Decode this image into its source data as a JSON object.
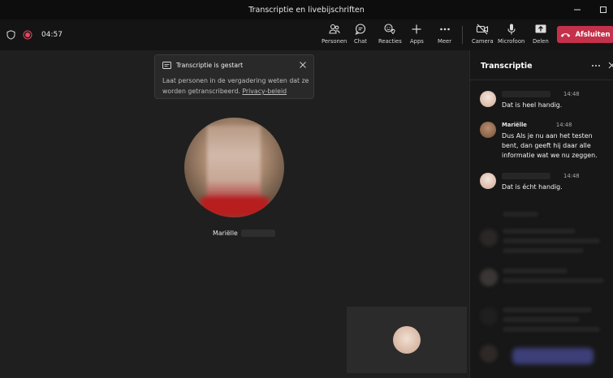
{
  "window": {
    "title": "Transcriptie en livebijschriften"
  },
  "meeting": {
    "timer": "04:57"
  },
  "toolbar": {
    "people": "Personen",
    "chat": "Chat",
    "reactions": "Reacties",
    "apps": "Apps",
    "more": "Meer",
    "camera": "Camera",
    "mic": "Microfoon",
    "share": "Delen",
    "leave": "Afsluiten"
  },
  "notification": {
    "title": "Transcriptie is gestart",
    "body": "Laat personen in de vergadering weten dat ze worden getranscribeerd.",
    "link": "Privacy-beleid"
  },
  "participant": {
    "name": "Mariëlle"
  },
  "transcript": {
    "title": "Transcriptie",
    "entries": [
      {
        "sender": "",
        "time": "14:48",
        "text": "Dat is heel handig."
      },
      {
        "sender": "Mariëlle",
        "time": "14:48",
        "text": "Dus Als je nu aan het testen bent, dan geeft hij daar alle informatie wat we nu zeggen."
      },
      {
        "sender": "",
        "time": "14:48",
        "text": "Dat is écht handig."
      }
    ]
  },
  "colors": {
    "leave_button": "#c4314b",
    "record_dot": "#e0495f"
  }
}
